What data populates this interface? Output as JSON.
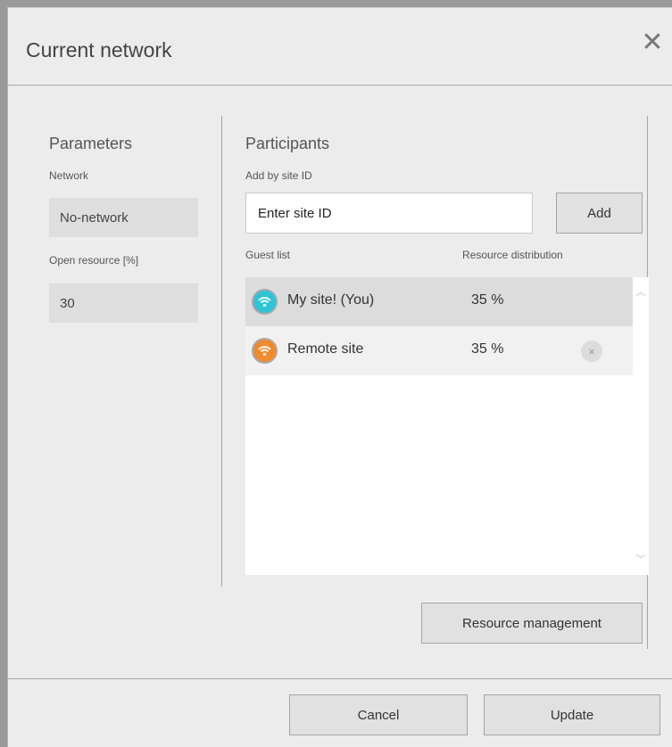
{
  "dialog": {
    "title": "Current network",
    "close_glyph": "✕"
  },
  "parameters": {
    "heading": "Parameters",
    "network_label": "Network",
    "network_value": "No-network",
    "open_resource_label": "Open resource [%]",
    "open_resource_value": "30"
  },
  "participants": {
    "heading": "Participants",
    "add_label": "Add by site ID",
    "site_id_placeholder": "Enter site ID",
    "add_button": "Add",
    "guest_list_header": "Guest list",
    "resource_header": "Resource distribution",
    "guests": [
      {
        "name": "My site! (You)",
        "percent": "35 %",
        "icon": "wifi-icon",
        "color": "#2ec4d6",
        "removable": false
      },
      {
        "name": "Remote site",
        "percent": "35 %",
        "icon": "wifi-icon",
        "color": "#f08a2c",
        "removable": true
      }
    ],
    "remove_glyph": "×",
    "resource_management_button": "Resource management"
  },
  "scroll": {
    "up_glyph": "︿",
    "down_glyph": "﹀"
  },
  "footer": {
    "cancel_button": "Cancel",
    "update_button": "Update"
  },
  "colors": {
    "selected_row": "#dcdcdc",
    "row": "#f1f1f1"
  }
}
